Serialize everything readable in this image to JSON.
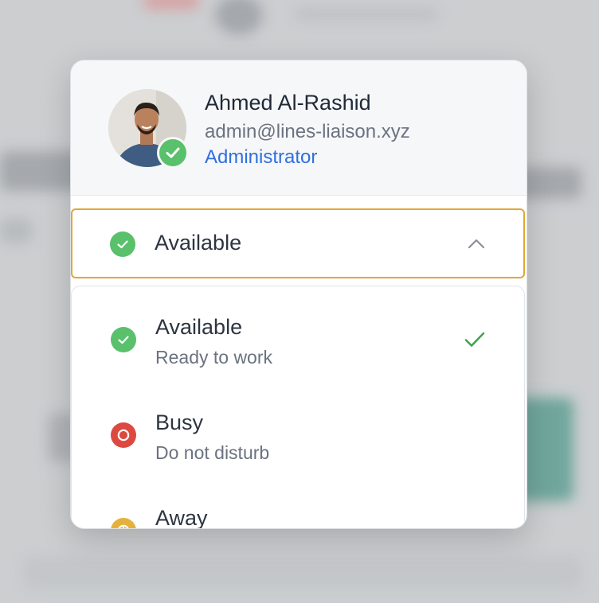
{
  "profile": {
    "name": "Ahmed Al-Rashid",
    "email": "admin@lines-liaison.xyz",
    "role": "Administrator",
    "presence_status": "available"
  },
  "status_select": {
    "current": "Available",
    "expanded": true,
    "color": "#59c06b",
    "accent_border": "#e0a63a"
  },
  "status_options": [
    {
      "title": "Available",
      "subtitle": "Ready to work",
      "color": "#59c06b",
      "icon": "check-circle-icon",
      "selected": true
    },
    {
      "title": "Busy",
      "subtitle": "Do not disturb",
      "color": "#dc4a3f",
      "icon": "busy-ring-icon",
      "selected": false
    },
    {
      "title": "Away",
      "subtitle": "",
      "color": "#e4b23c",
      "icon": "clock-icon",
      "selected": false
    }
  ],
  "colors": {
    "role_link": "#2f6fdf",
    "selected_check": "#3fa34d"
  }
}
